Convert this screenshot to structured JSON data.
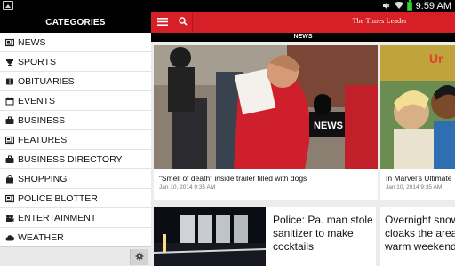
{
  "status_bar": {
    "time": "9:59 AM",
    "icons": [
      "gallery-icon",
      "mute-icon",
      "wifi-icon",
      "battery-icon"
    ]
  },
  "sidebar": {
    "title": "CATEGORIES",
    "items": [
      {
        "label": "NEWS",
        "icon": "newspaper-icon"
      },
      {
        "label": "SPORTS",
        "icon": "trophy-icon"
      },
      {
        "label": "OBITUARIES",
        "icon": "book-icon"
      },
      {
        "label": "EVENTS",
        "icon": "calendar-icon"
      },
      {
        "label": "BUSINESS",
        "icon": "briefcase-icon"
      },
      {
        "label": "FEATURES",
        "icon": "newspaper-icon"
      },
      {
        "label": "BUSINESS DIRECTORY",
        "icon": "briefcase-icon"
      },
      {
        "label": "SHOPPING",
        "icon": "shopping-bag-icon"
      },
      {
        "label": "POLICE BLOTTER",
        "icon": "newspaper-icon"
      },
      {
        "label": "ENTERTAINMENT",
        "icon": "film-icon"
      },
      {
        "label": "WEATHER",
        "icon": "cloud-icon"
      }
    ],
    "footer_icon": "gear-icon"
  },
  "header": {
    "logo": "The Times Leader",
    "section": "NEWS"
  },
  "articles": [
    {
      "title": "“Smell of death” inside trailer filled with dogs",
      "date": "Jan 10, 2014 9:35 AM"
    },
    {
      "title": "In Marvel’s Ultimate",
      "date": "Jan 10, 2014 9:35 AM"
    },
    {
      "title": "Police: Pa. man stole sanitizer to make cocktails"
    },
    {
      "title": "Overnight snow cloaks the area warm weekend"
    }
  ],
  "colors": {
    "brand": "#d61f26",
    "header_bg": "#000000"
  }
}
